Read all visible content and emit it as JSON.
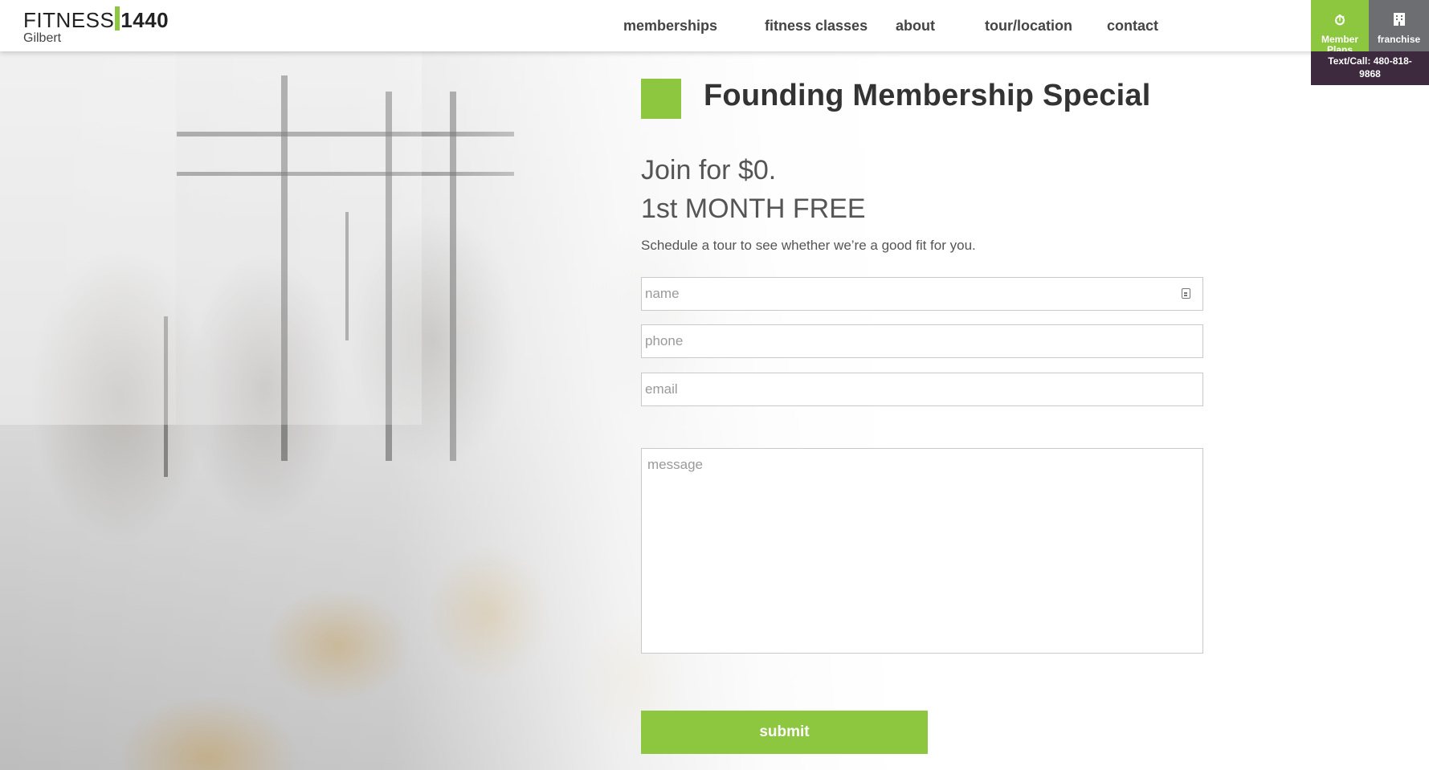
{
  "logo": {
    "brand_light": "FITNESS",
    "brand_bold": "1440",
    "location": "Gilbert"
  },
  "nav": [
    {
      "label": "memberships"
    },
    {
      "label": "fitness classes"
    },
    {
      "label": "about"
    },
    {
      "label": "tour/location"
    },
    {
      "label": "contact"
    }
  ],
  "side_buttons": {
    "member": {
      "label": "Member Plans",
      "icon": "stopwatch-icon"
    },
    "franchise": {
      "label": "franchise",
      "icon": "building-icon"
    },
    "call": "Text/Call: 480-818-9868"
  },
  "hero": {
    "title": "Founding Membership Special",
    "offer_line1": "Join for $0.",
    "offer_line2": "1st MONTH FREE",
    "tagline": "Schedule a tour to see whether we’re a good fit for you."
  },
  "form": {
    "name_placeholder": "name",
    "phone_placeholder": "phone",
    "email_placeholder": "email",
    "message_placeholder": "message",
    "submit_label": "submit"
  },
  "colors": {
    "accent_green": "#8dc63f",
    "franchise_gray": "#6d6e71",
    "call_bar": "#3d2a3f"
  }
}
